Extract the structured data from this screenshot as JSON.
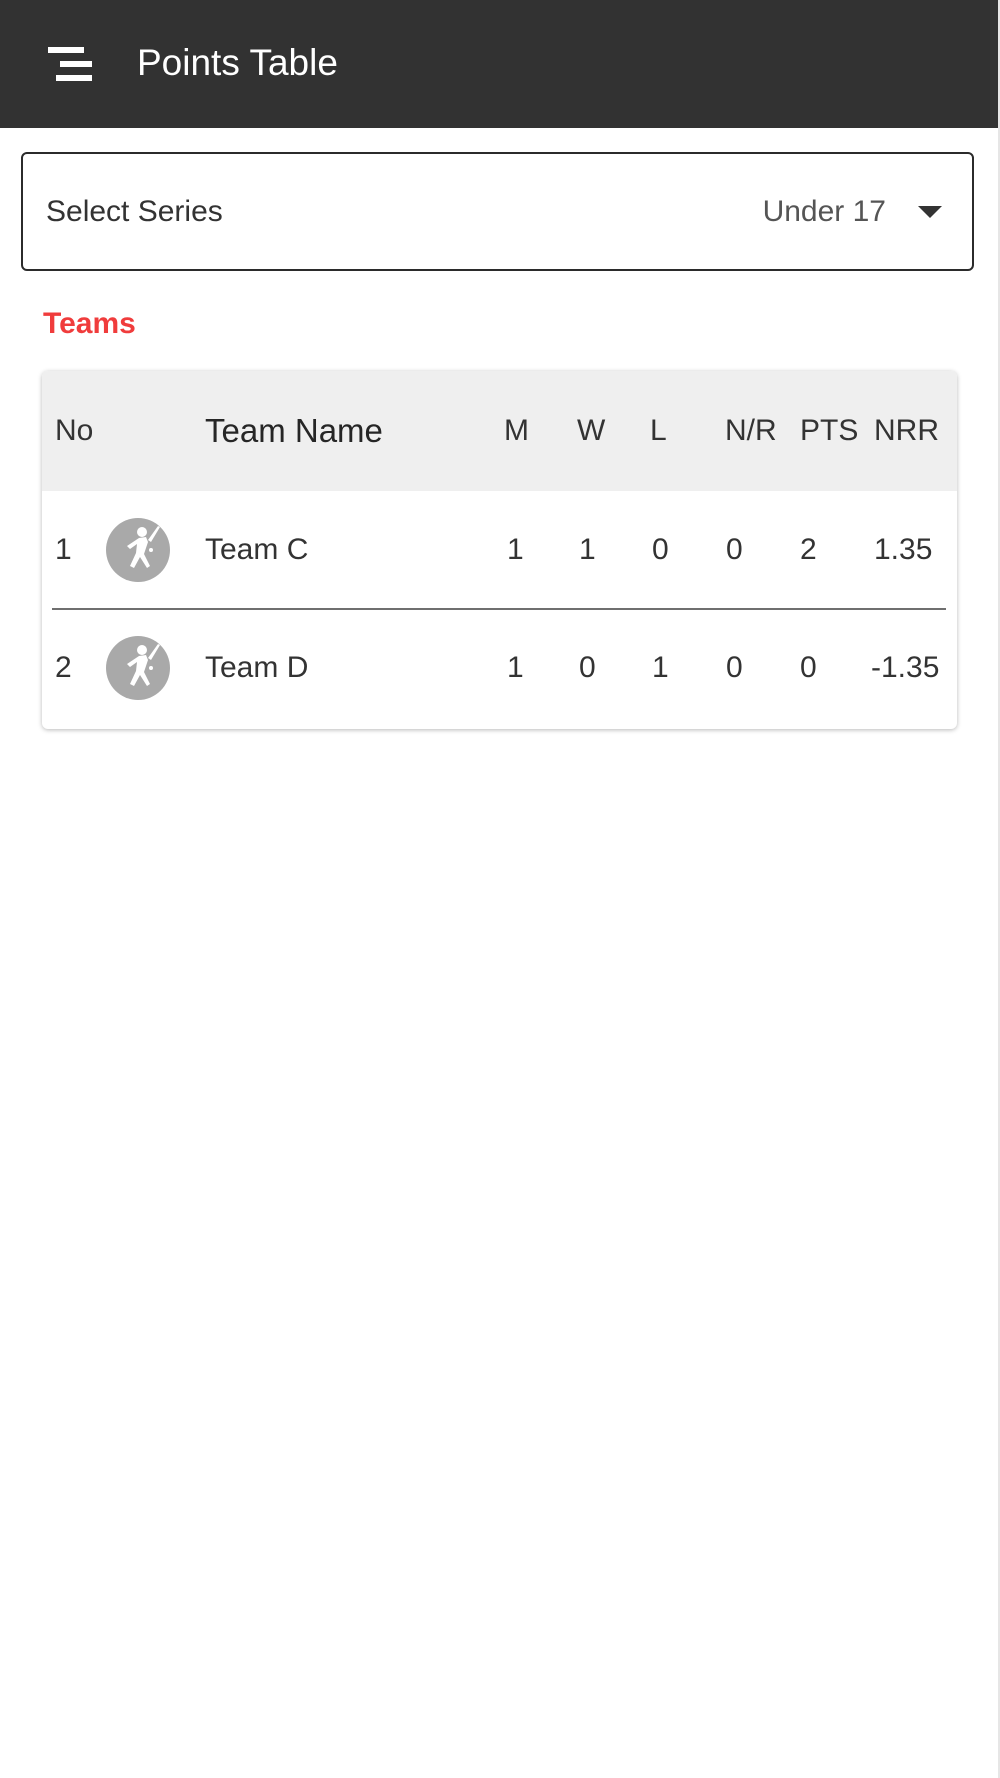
{
  "header": {
    "title": "Points Table",
    "menu_icon": "menu-icon"
  },
  "series_select": {
    "label": "Select Series",
    "value": "Under 17",
    "icon": "dropdown-arrow-icon"
  },
  "section": {
    "title": "Teams"
  },
  "points_table": {
    "columns": {
      "no": "No",
      "team_name": "Team Name",
      "m": "M",
      "w": "W",
      "l": "L",
      "nr": "N/R",
      "pts": "PTS",
      "nrr": "NRR"
    },
    "rows": [
      {
        "no": "1",
        "logo": "cricket-player-icon",
        "team": "Team C",
        "m": "1",
        "w": "1",
        "l": "0",
        "nr": "0",
        "pts": "2",
        "nrr": "1.35"
      },
      {
        "no": "2",
        "logo": "cricket-player-icon",
        "team": "Team D",
        "m": "1",
        "w": "0",
        "l": "1",
        "nr": "0",
        "pts": "0",
        "nrr": "-1.35"
      }
    ]
  },
  "colors": {
    "topbar": "#323232",
    "accent": "#f03c3c",
    "header_row": "#efefef",
    "logo_bg": "#a9a9a9"
  }
}
